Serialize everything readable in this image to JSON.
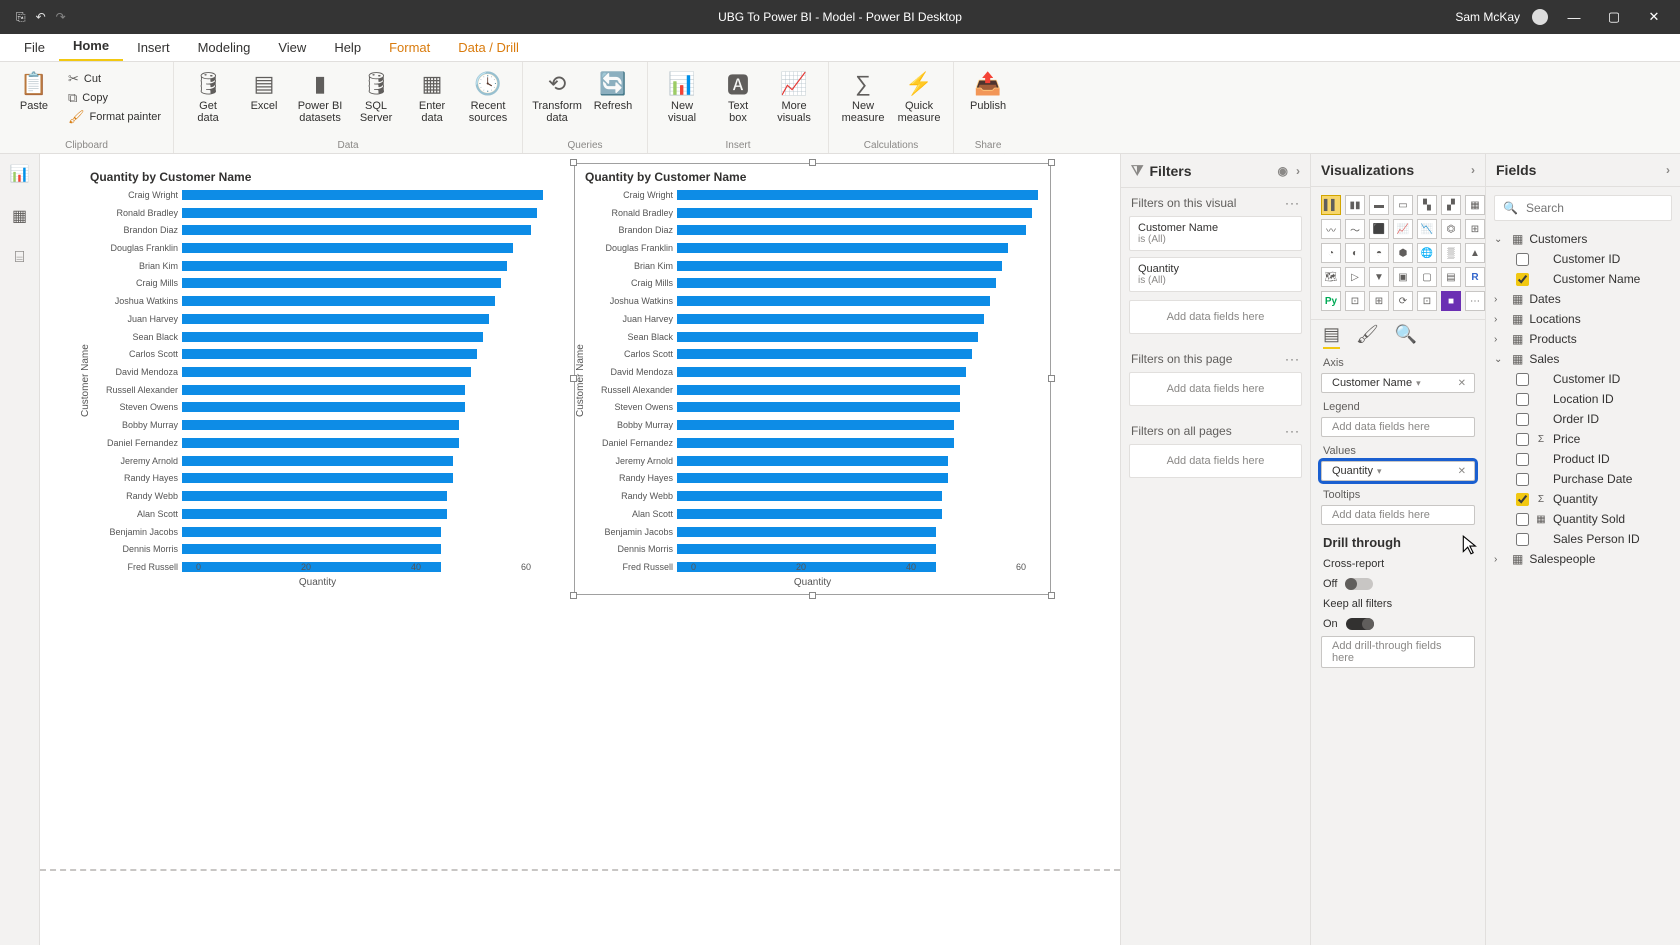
{
  "window": {
    "title": "UBG To Power BI - Model - Power BI Desktop",
    "user": "Sam McKay"
  },
  "menu": {
    "file": "File",
    "tabs": [
      "Home",
      "Insert",
      "Modeling",
      "View",
      "Help",
      "Format",
      "Data / Drill"
    ],
    "active": "Home",
    "accent_start_index": 5
  },
  "ribbon": {
    "clipboard": {
      "label": "Clipboard",
      "paste": "Paste",
      "cut": "Cut",
      "copy": "Copy",
      "painter": "Format painter"
    },
    "data": {
      "label": "Data",
      "get": "Get\ndata",
      "excel": "Excel",
      "pbi": "Power BI\ndatasets",
      "sql": "SQL\nServer",
      "enter": "Enter\ndata",
      "recent": "Recent\nsources"
    },
    "queries": {
      "label": "Queries",
      "transform": "Transform\ndata",
      "refresh": "Refresh"
    },
    "insert": {
      "label": "Insert",
      "visual": "New\nvisual",
      "textbox": "Text\nbox",
      "more": "More\nvisuals"
    },
    "calc": {
      "label": "Calculations",
      "measure": "New\nmeasure",
      "quick": "Quick\nmeasure"
    },
    "share": {
      "label": "Share",
      "publish": "Publish"
    }
  },
  "panes": {
    "filters": {
      "title": "Filters",
      "on_visual": "Filters on this visual",
      "on_page": "Filters on this page",
      "on_all": "Filters on all pages",
      "add": "Add data fields here",
      "cards": [
        {
          "name": "Customer Name",
          "cond": "is (All)"
        },
        {
          "name": "Quantity",
          "cond": "is (All)"
        }
      ]
    },
    "viz": {
      "title": "Visualizations",
      "axis": "Axis",
      "legend": "Legend",
      "values": "Values",
      "tooltips": "Tooltips",
      "add": "Add data fields here",
      "axis_field": "Customer Name",
      "value_field": "Quantity",
      "drill": "Drill through",
      "cross": "Cross-report",
      "cross_state": "Off",
      "keep": "Keep all filters",
      "keep_state": "On",
      "drill_add": "Add drill-through fields here"
    },
    "fields": {
      "title": "Fields",
      "search_ph": "Search",
      "tables": [
        {
          "name": "Customers",
          "open": true,
          "fields": [
            {
              "name": "Customer ID",
              "checked": false,
              "icon": ""
            },
            {
              "name": "Customer Name",
              "checked": true,
              "icon": ""
            }
          ]
        },
        {
          "name": "Dates",
          "open": false,
          "fields": []
        },
        {
          "name": "Locations",
          "open": false,
          "fields": []
        },
        {
          "name": "Products",
          "open": false,
          "fields": []
        },
        {
          "name": "Sales",
          "open": true,
          "fields": [
            {
              "name": "Customer ID",
              "checked": false,
              "icon": ""
            },
            {
              "name": "Location ID",
              "checked": false,
              "icon": ""
            },
            {
              "name": "Order ID",
              "checked": false,
              "icon": ""
            },
            {
              "name": "Price",
              "checked": false,
              "icon": "Σ"
            },
            {
              "name": "Product ID",
              "checked": false,
              "icon": ""
            },
            {
              "name": "Purchase Date",
              "checked": false,
              "icon": ""
            },
            {
              "name": "Quantity",
              "checked": true,
              "icon": "Σ"
            },
            {
              "name": "Quantity Sold",
              "checked": false,
              "icon": "▦"
            },
            {
              "name": "Sales Person ID",
              "checked": false,
              "icon": ""
            }
          ]
        },
        {
          "name": "Salespeople",
          "open": false,
          "fields": []
        }
      ]
    }
  },
  "chart_data": [
    {
      "type": "bar",
      "title": "Quantity by Customer Name",
      "xlabel": "Quantity",
      "ylabel": "Customer Name",
      "xlim": [
        0,
        60
      ],
      "xticks": [
        0,
        20,
        40,
        60
      ],
      "categories": [
        "Craig Wright",
        "Ronald Bradley",
        "Brandon Diaz",
        "Douglas Franklin",
        "Brian Kim",
        "Craig Mills",
        "Joshua Watkins",
        "Juan Harvey",
        "Sean Black",
        "Carlos Scott",
        "David Mendoza",
        "Russell Alexander",
        "Steven Owens",
        "Bobby Murray",
        "Daniel Fernandez",
        "Jeremy Arnold",
        "Randy Hayes",
        "Randy Webb",
        "Alan Scott",
        "Benjamin Jacobs",
        "Dennis Morris",
        "Fred Russell"
      ],
      "values": [
        60,
        59,
        58,
        55,
        54,
        53,
        52,
        51,
        50,
        49,
        48,
        47,
        47,
        46,
        46,
        45,
        45,
        44,
        44,
        43,
        43,
        43
      ]
    },
    {
      "type": "bar",
      "title": "Quantity by Customer Name",
      "xlabel": "Quantity",
      "ylabel": "Customer Name",
      "xlim": [
        0,
        60
      ],
      "xticks": [
        0,
        20,
        40,
        60
      ],
      "categories": [
        "Craig Wright",
        "Ronald Bradley",
        "Brandon Diaz",
        "Douglas Franklin",
        "Brian Kim",
        "Craig Mills",
        "Joshua Watkins",
        "Juan Harvey",
        "Sean Black",
        "Carlos Scott",
        "David Mendoza",
        "Russell Alexander",
        "Steven Owens",
        "Bobby Murray",
        "Daniel Fernandez",
        "Jeremy Arnold",
        "Randy Hayes",
        "Randy Webb",
        "Alan Scott",
        "Benjamin Jacobs",
        "Dennis Morris",
        "Fred Russell"
      ],
      "values": [
        60,
        59,
        58,
        55,
        54,
        53,
        52,
        51,
        50,
        49,
        48,
        47,
        47,
        46,
        46,
        45,
        45,
        44,
        44,
        43,
        43,
        43
      ]
    }
  ]
}
